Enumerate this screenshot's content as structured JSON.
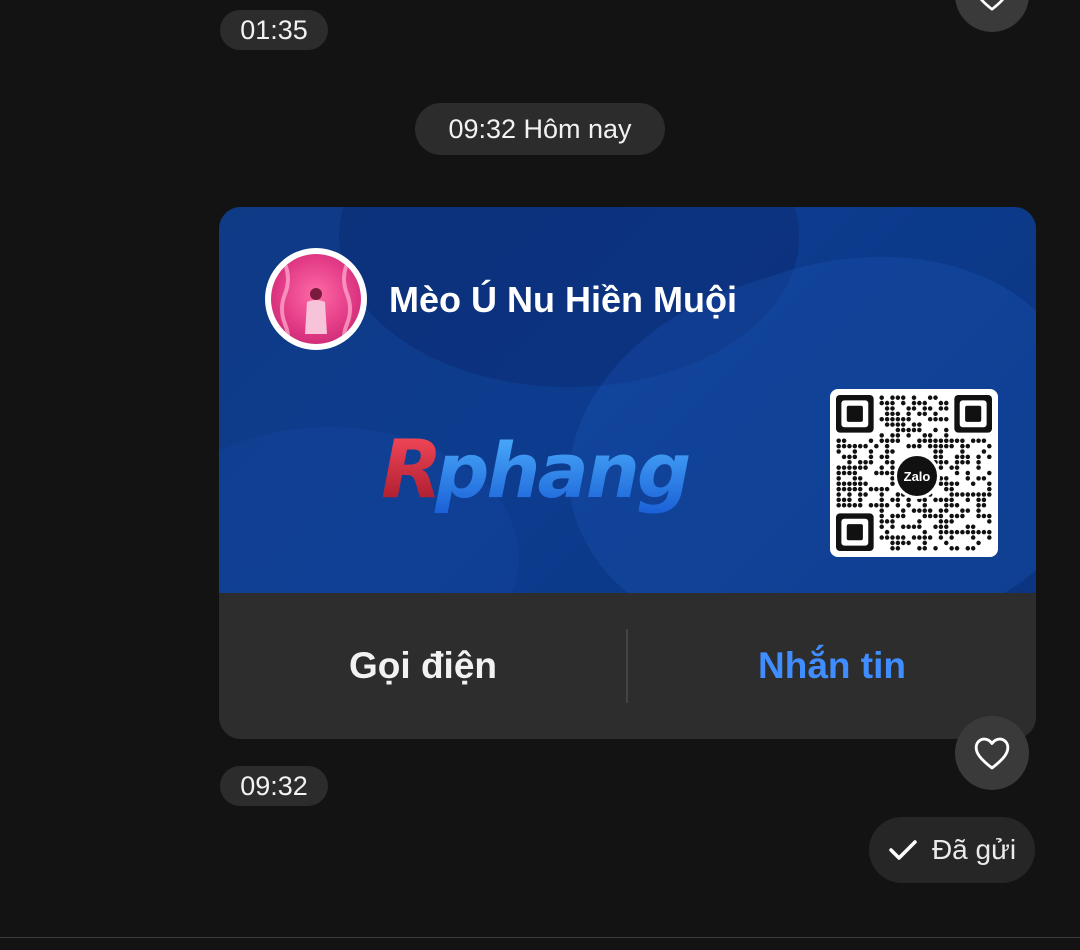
{
  "messages": {
    "time_top": "01:35",
    "date_separator": "09:32 Hôm nay",
    "time_bottom": "09:32",
    "sent_status": "Đã gửi"
  },
  "contact_card": {
    "name": "Mèo Ú Nu Hiền Muội",
    "logo_text": "Rphang",
    "qr_badge": "Zalo",
    "call_label": "Gọi điện",
    "message_label": "Nhắn tin"
  },
  "icons": {
    "reaction": "heart-icon",
    "sent": "check-icon"
  },
  "colors": {
    "background": "#131313",
    "card_blue": "#0d3c8f",
    "accent_blue": "#3f8dff",
    "pill": "#2c2c2c"
  }
}
